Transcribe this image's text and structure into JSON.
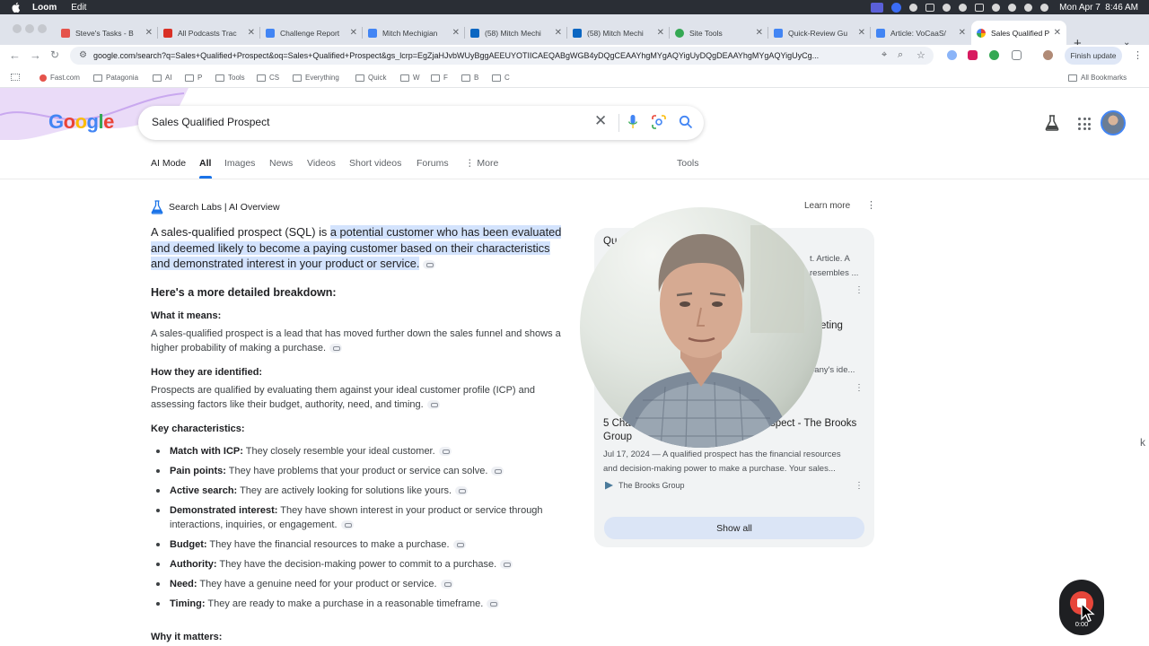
{
  "menubar": {
    "app": "Loom",
    "items": [
      "Edit"
    ],
    "datetime": "Mon Apr 7  8:46 AM"
  },
  "tabs": [
    {
      "label": "Steve's Tasks - B",
      "icon": "asana-icon",
      "color": "#e5534b"
    },
    {
      "label": "All Podcasts Trac",
      "icon": "sheet-red-icon",
      "color": "#d93025"
    },
    {
      "label": "Challenge Report",
      "icon": "docs-icon",
      "color": "#4285f4"
    },
    {
      "label": "Mitch Mechigian",
      "icon": "docs-icon",
      "color": "#4285f4"
    },
    {
      "label": "(58) Mitch Mechi",
      "icon": "linkedin-icon",
      "color": "#0a66c2"
    },
    {
      "label": "(58) Mitch Mechi",
      "icon": "linkedin-icon",
      "color": "#0a66c2"
    },
    {
      "label": "Site Tools",
      "icon": "g-icon",
      "color": "#34a853"
    },
    {
      "label": "Quick-Review Gu",
      "icon": "docs-icon",
      "color": "#4285f4"
    },
    {
      "label": "Article: VoCaaS/",
      "icon": "docs-icon",
      "color": "#4285f4"
    },
    {
      "label": "Sales Qualified P",
      "icon": "google-icon",
      "color": "#4285f4",
      "active": true
    }
  ],
  "toolbar": {
    "url": "google.com/search?q=Sales+Qualified+Prospect&oq=Sales+Qualified+Prospect&gs_lcrp=EgZjaHJvbWUyBggAEEUYOTIICAEQABgWGB4yDQgCEAAYhgMYgAQYigUyDQgDEAAYhgMYgAQYigUyCg...",
    "finish_update": "Finish update"
  },
  "bookmarks": {
    "items": [
      "Fast.com",
      "Patagonia",
      "AI",
      "P",
      "Tools",
      "CS",
      "Everything",
      "Quick",
      "W",
      "F",
      "B",
      "C"
    ],
    "all": "All Bookmarks"
  },
  "google": {
    "logo": "Google",
    "query": "Sales Qualified Prospect",
    "tabs": [
      "AI Mode",
      "All",
      "Images",
      "News",
      "Videos",
      "Short videos",
      "Forums",
      "More"
    ],
    "active_tab": "All",
    "tools": "Tools"
  },
  "ai_overview": {
    "label": "Search Labs | AI Overview",
    "learn_more": "Learn more",
    "intro_plain": "A sales-qualified prospect (SQL) is ",
    "intro_highlight": "a potential customer who has been evaluated and deemed likely to become a paying customer based on their characteristics and demonstrated interest in your product or service.",
    "breakdown_heading": "Here's a more detailed breakdown:",
    "sections": [
      {
        "heading": "What it means:",
        "text": "A sales-qualified prospect is a lead that has moved further down the sales funnel and shows a higher probability of making a purchase."
      },
      {
        "heading": "How they are identified:",
        "text": "Prospects are qualified by evaluating them against your ideal customer profile (ICP) and assessing factors like their budget, authority, need, and timing."
      }
    ],
    "key_heading": "Key characteristics:",
    "key_items": [
      {
        "term": "Match with ICP:",
        "text": " They closely resemble your ideal customer."
      },
      {
        "term": "Pain points:",
        "text": " They have problems that your product or service can solve."
      },
      {
        "term": "Active search:",
        "text": " They are actively looking for solutions like yours."
      },
      {
        "term": "Demonstrated interest:",
        "text": " They have shown interest in your product or service through interactions, inquiries, or engagement."
      },
      {
        "term": "Budget:",
        "text": " They have the financial resources to make a purchase."
      },
      {
        "term": "Authority:",
        "text": " They have the decision-making power to commit to a purchase."
      },
      {
        "term": "Need:",
        "text": " They have a genuine need for your product or service."
      },
      {
        "term": "Timing:",
        "text": " They are ready to make a purchase in a reasonable timeframe."
      }
    ],
    "why_heading": "Why it matters:"
  },
  "sources": {
    "s1_title_start": "Qu",
    "s1_snip_a": "t. Article. A",
    "s1_snip_b": "resembles ...",
    "s2_title_end": "eting",
    "s2_snip_a": "n",
    "s2_snip_b": "pany's ide...",
    "s3_title_a_start": "5 Cha",
    "s3_title_a_end": "spect - The Brooks",
    "s3_title_b": "Group",
    "s3_snip_a": "Jul 17, 2024 — A qualified prospect has the financial resources",
    "s3_snip_b": "and decision-making power to make a purchase. Your sales...",
    "s3_site": "The Brooks Group",
    "show_all": "Show all"
  },
  "loom": {
    "timer": "0:00"
  },
  "colors": {
    "highlight": "#d3e3fd",
    "link_blue": "#1a73e8",
    "loom_red": "#e7463a"
  }
}
